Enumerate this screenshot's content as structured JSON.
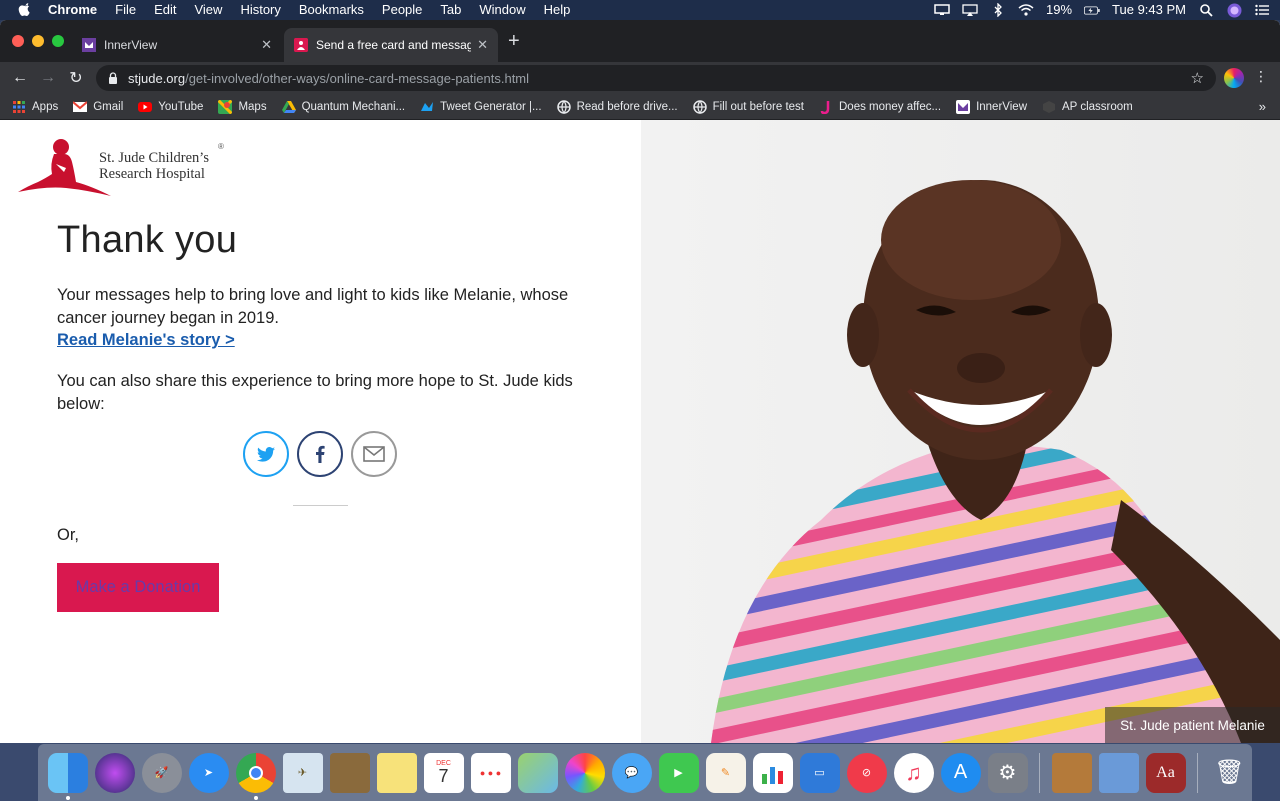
{
  "menubar": {
    "app": "Chrome",
    "items": [
      "File",
      "Edit",
      "View",
      "History",
      "Bookmarks",
      "People",
      "Tab",
      "Window",
      "Help"
    ],
    "battery": "19%",
    "clock": "Tue 9:43 PM"
  },
  "tabs": [
    {
      "title": "InnerView",
      "active": false
    },
    {
      "title": "Send a free card and message",
      "active": true
    }
  ],
  "address": {
    "host": "stjude.org",
    "path": "/get-involved/other-ways/online-card-message-patients.html"
  },
  "bookmarks": [
    {
      "label": "Apps",
      "icon": "apps-grid-icon"
    },
    {
      "label": "Gmail",
      "icon": "gmail-icon"
    },
    {
      "label": "YouTube",
      "icon": "youtube-icon"
    },
    {
      "label": "Maps",
      "icon": "maps-icon"
    },
    {
      "label": "Quantum Mechani...",
      "icon": "drive-icon"
    },
    {
      "label": "Tweet Generator |...",
      "icon": "bird-icon"
    },
    {
      "label": "Read before drive...",
      "icon": "globe-icon"
    },
    {
      "label": "Fill out before test",
      "icon": "globe-icon"
    },
    {
      "label": "Does money affec...",
      "icon": "j-icon"
    },
    {
      "label": "InnerView",
      "icon": "innerview-icon"
    },
    {
      "label": "AP classroom",
      "icon": "ap-icon"
    }
  ],
  "logo": {
    "line1": "St. Jude Children’s",
    "line2": "Research Hospital",
    "reg": "®"
  },
  "content": {
    "heading": "Thank you",
    "paragraph1": "Your messages help to bring love and light to kids like Melanie, whose cancer journey began in 2019.",
    "story_link": "Read Melanie's story >",
    "paragraph2": "You can also share this experience to bring more hope to St. Jude kids below:",
    "or_text": "Or,",
    "donate_label": "Make a Donation"
  },
  "photo": {
    "caption": "St. Jude patient Melanie"
  },
  "colors": {
    "brand_red": "#d9184f",
    "link_blue": "#1a5cad",
    "twitter": "#1da1f2",
    "facebook": "#2d4373"
  },
  "dock": [
    "finder-icon",
    "siri-icon",
    "launchpad-icon",
    "safari-icon",
    "chrome-icon",
    "mail-icon",
    "notefile-icon",
    "notes-icon",
    "calendar-icon",
    "reminders-icon",
    "maps-icon",
    "photos-icon",
    "messages-icon",
    "facetime-icon",
    "pages-icon",
    "numbers-icon",
    "keynote-icon",
    "news-icon",
    "music-icon",
    "appstore-icon",
    "system-preferences-icon",
    "calculator-icon",
    "preview-icon",
    "dictionary-icon",
    "trash-icon"
  ],
  "calendar_date": {
    "month": "DEC",
    "day": "7"
  }
}
